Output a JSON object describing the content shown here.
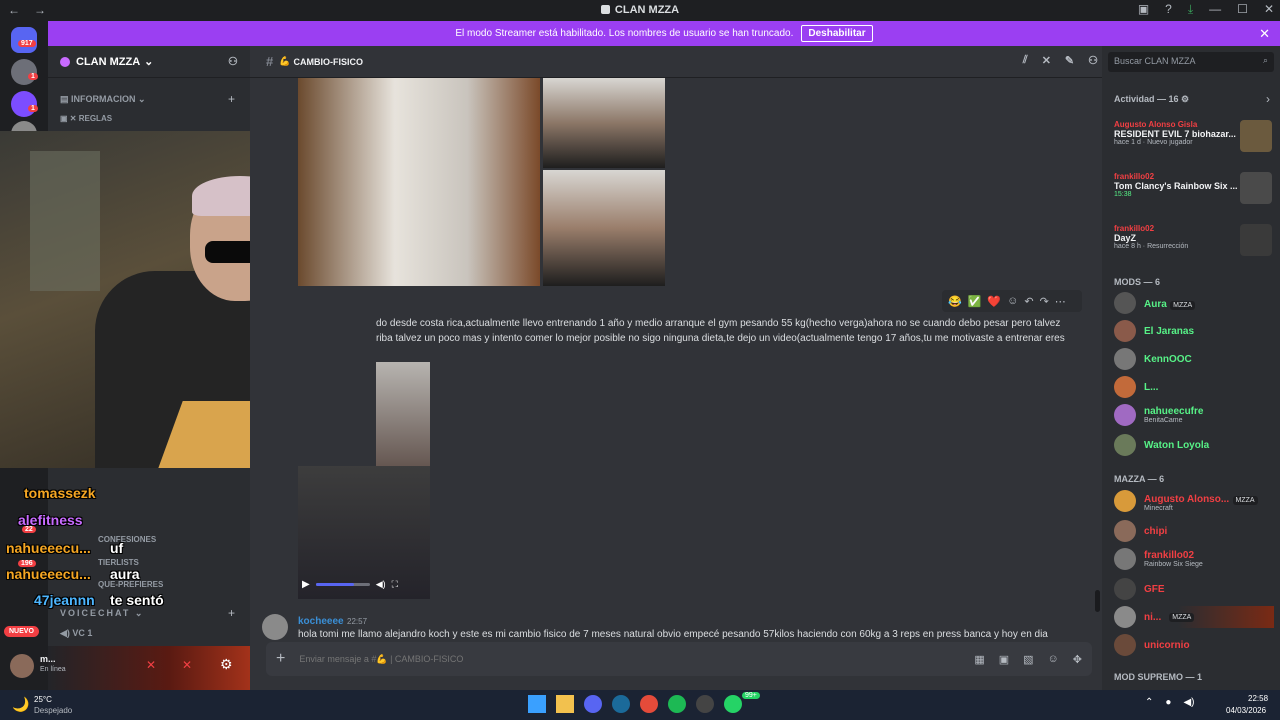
{
  "window": {
    "title": "CLAN MZZA",
    "back": "←",
    "forward": "→",
    "controls": [
      "▣",
      "?",
      "⤓",
      "—",
      "☐",
      "✕"
    ]
  },
  "banner": {
    "text": "El modo Streamer está habilitado. Los nombres de usuario se han truncado.",
    "button": "Deshabilitar",
    "close": "✕"
  },
  "guilds": {
    "badges": [
      "917",
      "1",
      "1"
    ]
  },
  "sidebar": {
    "server_name": "CLAN MZZA",
    "category_info": "INFORMACION",
    "channel_rules": "REGLAS",
    "channels_lower": [
      "CONFESIONES",
      "TIERLISTS",
      "QUE-PREFIERES"
    ],
    "voice_category": "VOICECHAT",
    "voice_channel": "VC 1",
    "nuevo_badge": "NUEVO",
    "user_name": "m...",
    "user_status": "En línea",
    "badges": [
      "22",
      "196"
    ]
  },
  "stream_chat": [
    {
      "name": "tomassezk",
      "color": "#f5a623"
    },
    {
      "name": "alefitness",
      "color": "#c86bff"
    },
    {
      "name": "nahueeecu...",
      "text": "uf",
      "color": "#f5a623"
    },
    {
      "name": "nahueeecu...",
      "text": "aura",
      "color": "#f5a623"
    },
    {
      "name": "47jeannn",
      "text": "te sentó",
      "color": "#4db6ff"
    }
  ],
  "chat": {
    "channel_name": "CAMBIO-FISICO",
    "message1_line1": "do desde costa rica,actualmente llevo entrenando 1 año y medio arranque el gym pesando 55 kg(hecho verga)ahora no se cuando debo pesar pero talvez",
    "message1_line2": "riba talvez un poco mas y intento comer lo mejor posible no sigo ninguna dieta,te dejo un video(actualmente tengo 17 años,tu me motivaste a entrenar eres",
    "reactions": [
      "😂",
      "✅",
      "❤️"
    ],
    "author2": "kocheeee",
    "time2": "22:57",
    "message2": "hola tomi me llamo alejandro koch y este es mi cambio fisico de 7 meses natural obvio empecé pesando 57kilos haciendo con 60kg a 3 reps en press banca y hoy en dia",
    "composer_placeholder": "Enviar mensaje a #💪 | CAMBIO-FISICO",
    "video_progress": 0.7
  },
  "members": {
    "search_placeholder": "Buscar CLAN MZZA",
    "activity_header": "Actividad — 16",
    "activities": [
      {
        "who": "Augusto Alonso Gisla",
        "game": "RESIDENT EVIL 7 biohazar...",
        "meta": "hace 1 d · Nuevo jugador"
      },
      {
        "who": "frankillo02",
        "game": "Tom Clancy's Rainbow Six ...",
        "meta": "15:38"
      },
      {
        "who": "frankillo02",
        "game": "DayZ",
        "meta": "hace 8 h · Resurrección"
      }
    ],
    "mods_header": "MODS — 6",
    "mods": [
      {
        "name": "Aura",
        "tag": "MZZA",
        "color": "#57f287"
      },
      {
        "name": "El Jaranas",
        "color": "#57f287"
      },
      {
        "name": "KennOOC",
        "color": "#57f287"
      },
      {
        "name": "L...",
        "color": "#57f287"
      },
      {
        "name": "nahueecufre",
        "sub": "BenitaCame",
        "color": "#57f287"
      },
      {
        "name": "Waton Loyola",
        "color": "#57f287"
      }
    ],
    "mzza_header": "MAZZA — 6",
    "mzza": [
      {
        "name": "Augusto Alonso...",
        "sub": "Minecraft",
        "tag": "MZZA",
        "color": "#f23f43"
      },
      {
        "name": "chipi",
        "color": "#f23f43"
      },
      {
        "name": "frankillo02",
        "sub": "Rainbow Six Siege",
        "color": "#f23f43"
      },
      {
        "name": "GFE",
        "color": "#f23f43"
      },
      {
        "name": "ni...",
        "tag": "MZZA",
        "color": "#f23f43"
      },
      {
        "name": "unicornio",
        "color": "#f23f43"
      }
    ],
    "supremo_header": "MOD SUPREMO — 1"
  },
  "taskbar": {
    "temp": "25°C",
    "weather": "Despejado",
    "time": "22:58",
    "date": "04/03/2026",
    "badge": "99+"
  }
}
